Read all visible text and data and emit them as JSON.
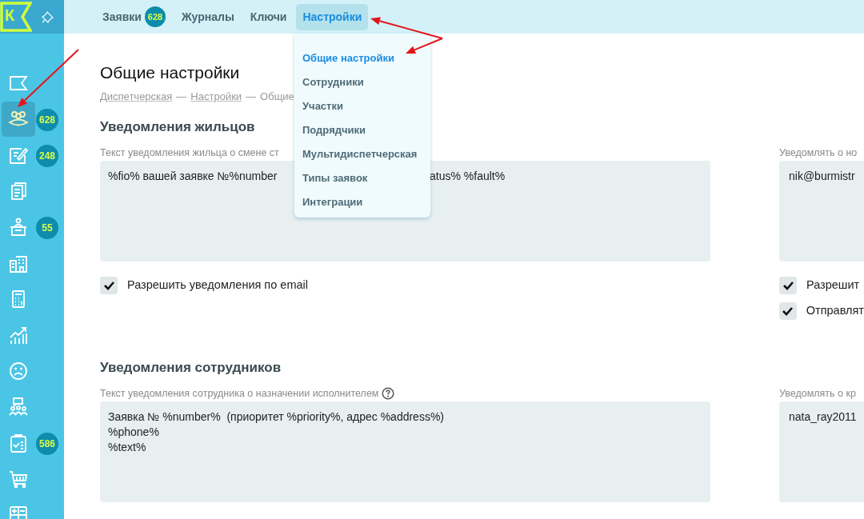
{
  "logo": {
    "letter": "К"
  },
  "top_nav": [
    {
      "label": "Заявки",
      "badge": "628",
      "selected": false
    },
    {
      "label": "Журналы",
      "selected": false
    },
    {
      "label": "Ключи",
      "selected": false
    },
    {
      "label": "Настройки",
      "selected": true
    }
  ],
  "dropdown": [
    {
      "label": "Общие настройки",
      "selected": true
    },
    {
      "label": "Сотрудники",
      "selected": false
    },
    {
      "label": "Участки",
      "selected": false
    },
    {
      "label": "Подрядчики",
      "selected": false
    },
    {
      "label": "Мультидиспетчерская",
      "selected": false
    },
    {
      "label": "Типы заявок",
      "selected": false
    },
    {
      "label": "Интеграции",
      "selected": false
    }
  ],
  "sidebar": [
    {
      "selected": false
    },
    {
      "selected": true,
      "badge": "628"
    },
    {
      "selected": false,
      "badge": "248"
    },
    {
      "selected": false
    },
    {
      "selected": false,
      "badge": "55"
    },
    {
      "selected": false
    },
    {
      "selected": false
    },
    {
      "selected": false
    },
    {
      "selected": false
    },
    {
      "selected": false
    },
    {
      "selected": false,
      "badge": "586"
    },
    {
      "selected": false
    },
    {
      "selected": false
    }
  ],
  "page_title": "Общие настройки",
  "breadcrumbs": {
    "separator": "—",
    "items": [
      {
        "label": "Диспетчерская",
        "kind": "link"
      },
      {
        "label": "Настройки",
        "kind": "link"
      },
      {
        "label": "Общие",
        "kind": "text"
      }
    ]
  },
  "sections": [
    {
      "title": "Уведомления жильцов",
      "left": {
        "label": "Текст уведомления жильца о смене ст",
        "value_parts": [
          "%fio% вашей заявке №%number",
          "atus% %fault%"
        ],
        "checkboxes": [
          {
            "label": "Разрешить уведомления по email",
            "checked": true
          }
        ]
      },
      "right": {
        "label": "Уведомлять о но",
        "value_parts": [
          "nik@burmistr"
        ],
        "checkboxes": [
          {
            "label": "Разрешит",
            "checked": true
          },
          {
            "label": "Отправлят",
            "checked": true
          }
        ]
      }
    },
    {
      "title": "Уведомления сотрудников",
      "left": {
        "label": "Текст уведомления сотрудника о назначении исполнителем",
        "help": true,
        "value_parts": [
          "Заявка № %number%  (приоритет %priority%, адрес %address%)\n%phone%\n%text%"
        ]
      },
      "right": {
        "label": "Уведомлять о кр",
        "value_parts": [
          "nata_ray2011"
        ]
      }
    }
  ]
}
